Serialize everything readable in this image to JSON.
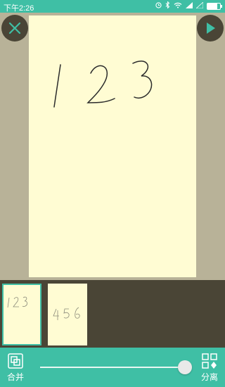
{
  "status": {
    "time": "下午2:26"
  },
  "editor": {
    "page_label": "123"
  },
  "thumbnails": [
    {
      "label": "123",
      "active": true
    },
    {
      "label": "456",
      "active": false
    }
  ],
  "toolbar": {
    "merge_label": "合并",
    "split_label": "分离",
    "slider_value": 0.97
  },
  "colors": {
    "accent": "#3fbfa5",
    "paper": "#fffcd3",
    "dark": "#4a4536",
    "background": "#b8b298"
  }
}
